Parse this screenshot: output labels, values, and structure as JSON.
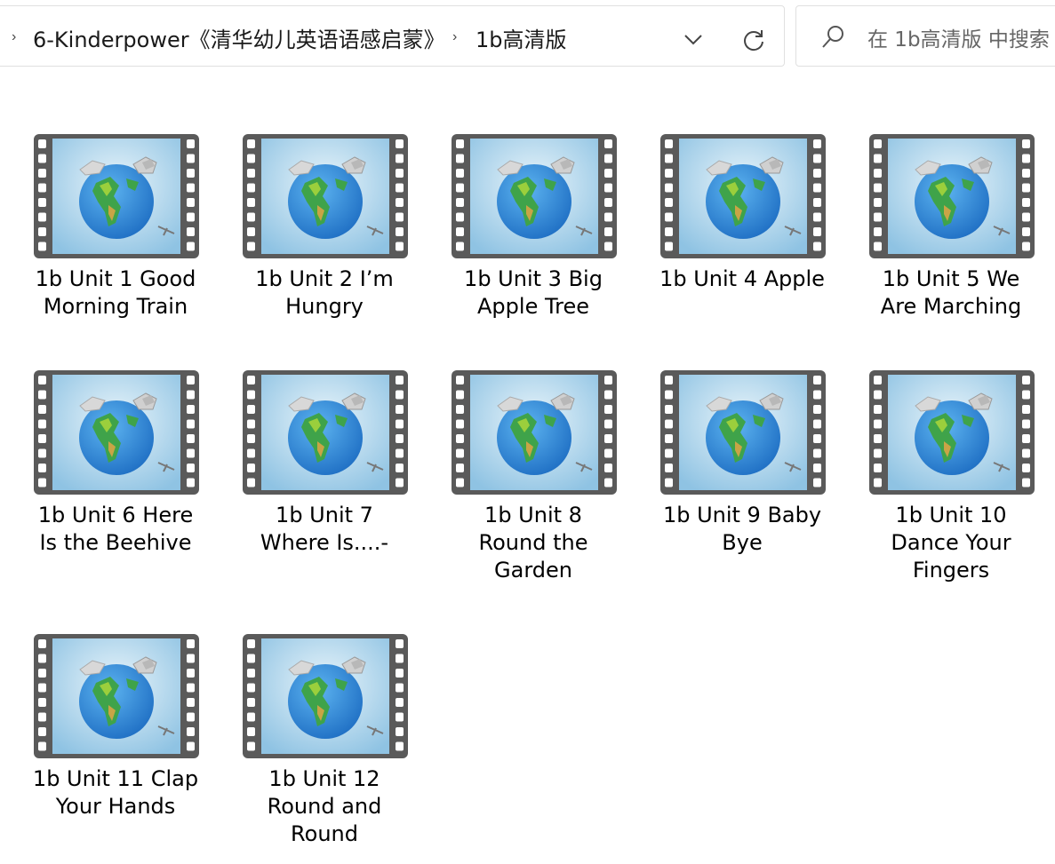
{
  "address": {
    "breadcrumbs": [
      "6-Kinderpower《清华幼儿英语语感启蒙》",
      "1b高清版"
    ],
    "dropdown_icon": "chevron-down-icon",
    "refresh_icon": "refresh-icon"
  },
  "search": {
    "placeholder": "在 1b高清版 中搜索"
  },
  "files": [
    {
      "name": "1b Unit 1 Good\nMorning Train",
      "type": "video"
    },
    {
      "name": "1b Unit 2 I’m\nHungry",
      "type": "video"
    },
    {
      "name": "1b Unit 3 Big\nApple Tree",
      "type": "video"
    },
    {
      "name": "1b Unit 4 Apple",
      "type": "video"
    },
    {
      "name": "1b Unit 5 We\nAre Marching",
      "type": "video"
    },
    {
      "name": "1b Unit 6 Here\nIs the Beehive",
      "type": "video"
    },
    {
      "name": "1b Unit 7\nWhere Is....-",
      "type": "video"
    },
    {
      "name": "1b Unit 8\nRound the\nGarden",
      "type": "video"
    },
    {
      "name": "1b Unit 9 Baby\nBye",
      "type": "video"
    },
    {
      "name": "1b Unit 10\nDance Your\nFingers",
      "type": "video"
    },
    {
      "name": "1b Unit 11 Clap\nYour Hands",
      "type": "video"
    },
    {
      "name": "1b Unit 12\nRound and\nRound",
      "type": "video"
    }
  ]
}
